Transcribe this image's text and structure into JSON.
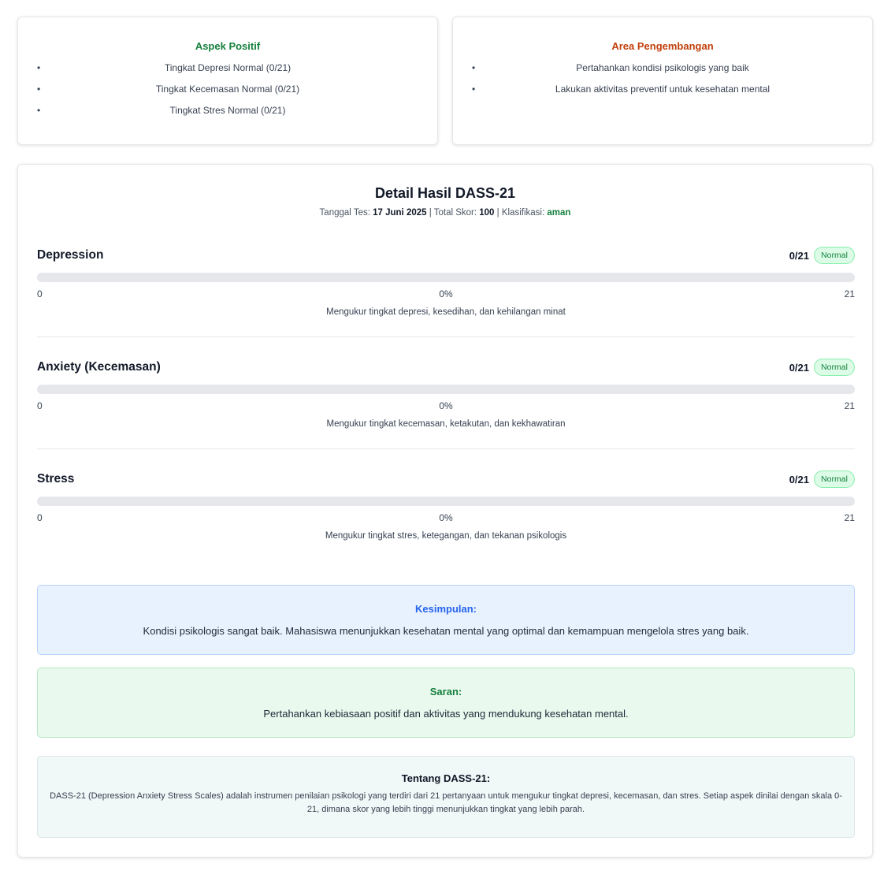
{
  "positive": {
    "title": "Aspek Positif",
    "items": [
      "Tingkat Depresi Normal (0/21)",
      "Tingkat Kecemasan Normal (0/21)",
      "Tingkat Stres Normal (0/21)"
    ]
  },
  "development": {
    "title": "Area Pengembangan",
    "items": [
      "Pertahankan kondisi psikologis yang baik",
      "Lakukan aktivitas preventif untuk kesehatan mental"
    ]
  },
  "bullet": "•",
  "detail": {
    "title": "Detail Hasil DASS-21",
    "date_label": "Tanggal Tes:",
    "date_value": "17 Juni 2025",
    "sep": "|",
    "total_label": "Total Skor:",
    "total_value": "100",
    "class_label": "Klasifikasi:",
    "class_value": "aman"
  },
  "metrics": [
    {
      "name": "Depression",
      "score": "0/21",
      "badge": "Normal",
      "progress": 0,
      "min": "0",
      "percent": "0%",
      "max": "21",
      "desc": "Mengukur tingkat depresi, kesedihan, dan kehilangan minat"
    },
    {
      "name": "Anxiety (Kecemasan)",
      "score": "0/21",
      "badge": "Normal",
      "progress": 0,
      "min": "0",
      "percent": "0%",
      "max": "21",
      "desc": "Mengukur tingkat kecemasan, ketakutan, dan kekhawatiran"
    },
    {
      "name": "Stress",
      "score": "0/21",
      "badge": "Normal",
      "progress": 0,
      "min": "0",
      "percent": "0%",
      "max": "21",
      "desc": "Mengukur tingkat stres, ketegangan, dan tekanan psikologis"
    }
  ],
  "conclusion": {
    "title": "Kesimpulan:",
    "text": "Kondisi psikologis sangat baik. Mahasiswa menunjukkan kesehatan mental yang optimal dan kemampuan mengelola stres yang baik."
  },
  "advice": {
    "title": "Saran:",
    "text": "Pertahankan kebiasaan positif dan aktivitas yang mendukung kesehatan mental."
  },
  "about": {
    "title": "Tentang DASS-21:",
    "text": "DASS-21 (Depression Anxiety Stress Scales) adalah instrumen penilaian psikologi yang terdiri dari 21 pertanyaan untuk mengukur tingkat depresi, kecemasan, dan stres. Setiap aspek dinilai dengan skala 0-21, dimana skor yang lebih tinggi menunjukkan tingkat yang lebih parah."
  },
  "colors": {
    "positive_title": "#15803d",
    "development_title": "#c2410c",
    "normal_badge": "#15803d",
    "conclusion_title": "#2563eb"
  }
}
